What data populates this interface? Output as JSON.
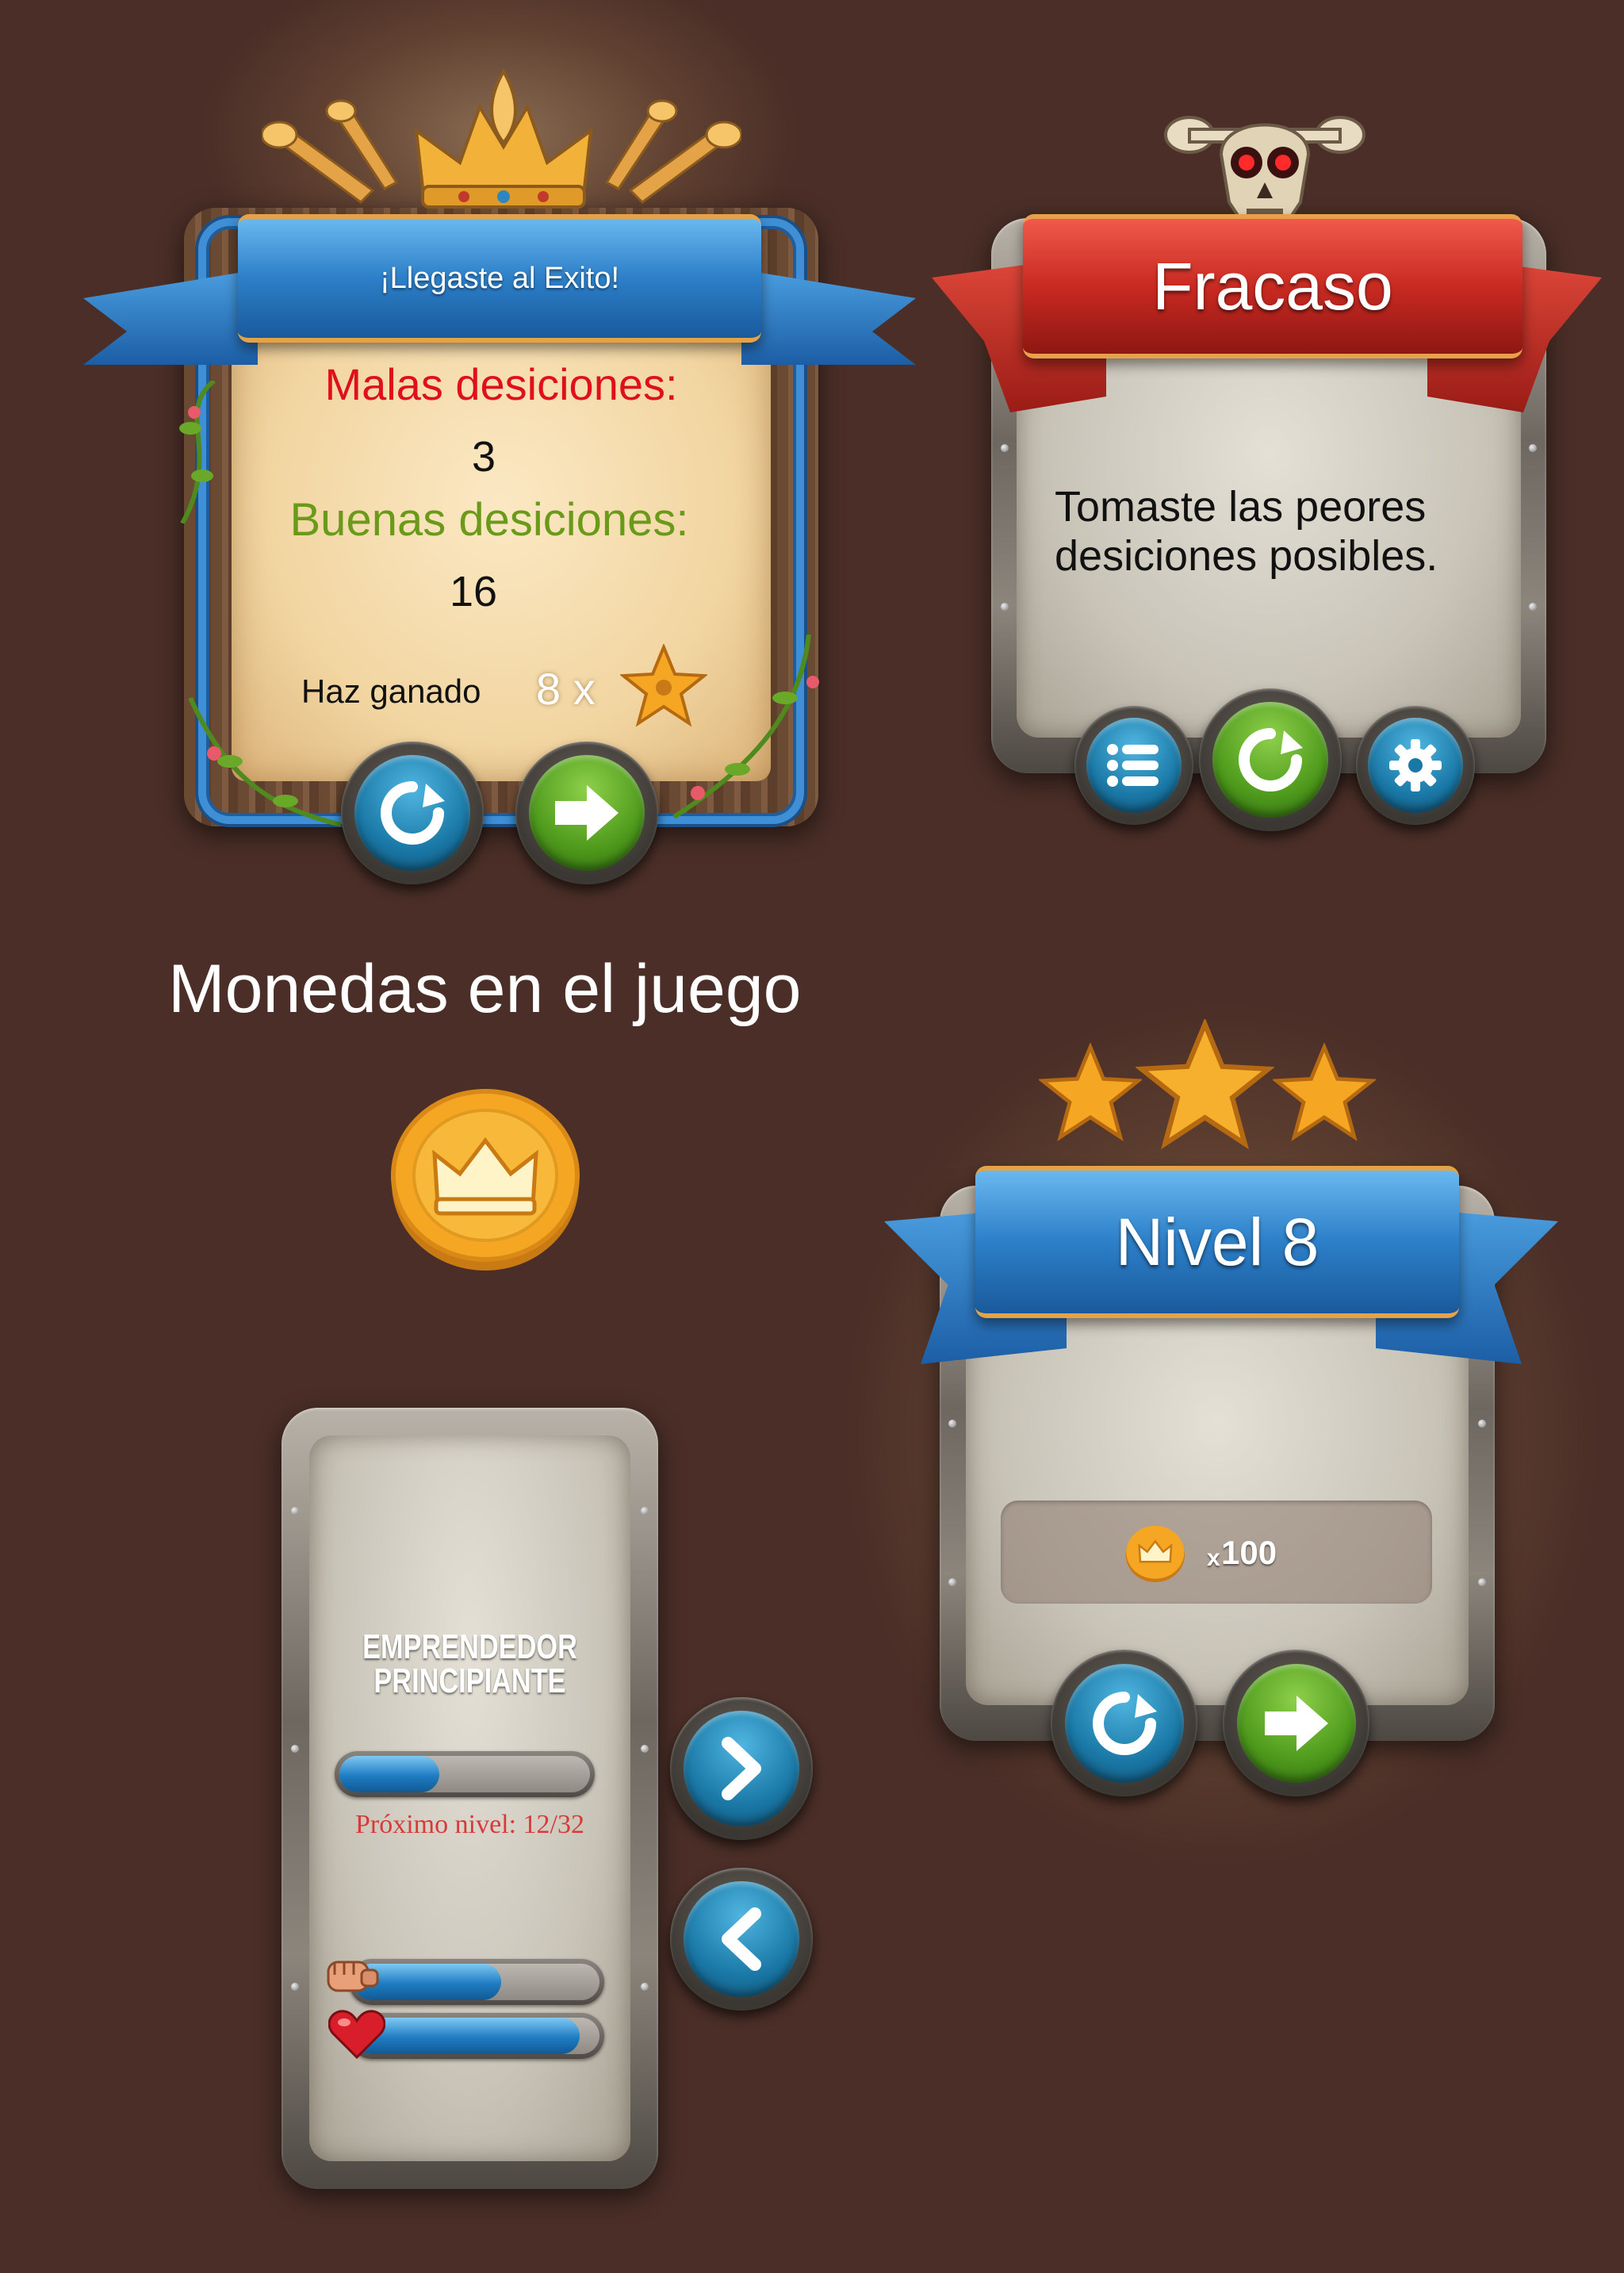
{
  "colors": {
    "background": "#4a2e27",
    "bad_red": "#e0101a",
    "good_green": "#6a9a1a",
    "progress_red": "#d83a3a",
    "ribbon_blue": "#2c7fc8",
    "ribbon_red": "#c92a22",
    "button_blue": "#1a78a6",
    "button_green": "#4e9a1c",
    "gold": "#f5a623"
  },
  "success_panel": {
    "title": "¡Llegaste al Exito!",
    "bad_label": "Malas desiciones:",
    "bad_value": "3",
    "good_label": "Buenas desiciones:",
    "good_value": "16",
    "earned_label": "Haz ganado",
    "earned_multiplier": "8 x",
    "icons": [
      "crown-icon",
      "trumpet-icon",
      "star-icon",
      "vine-icon"
    ],
    "buttons": [
      "retry-icon",
      "next-arrow-icon"
    ]
  },
  "failure_panel": {
    "title": "Fracaso",
    "message_line1": "Tomaste las peores",
    "message_line2": "desiciones posibles.",
    "icons": [
      "skull-icon"
    ],
    "buttons": [
      "menu-list-icon",
      "retry-icon",
      "gear-icon"
    ]
  },
  "coins_section": {
    "title": "Monedas en el juego",
    "icon": "crown-coin-icon"
  },
  "level_panel": {
    "title": "Nivel 8",
    "stars": 3,
    "reward_prefix": "x",
    "reward_amount": "100",
    "buttons": [
      "retry-icon",
      "next-arrow-icon"
    ]
  },
  "profile_panel": {
    "rank_line1": "EMPRENDEDOR",
    "rank_line2": "PRINCIPIANTE",
    "xp_fraction": 0.4,
    "next_level_text": "Próximo nivel: 12/32",
    "strength_fraction": 0.6,
    "health_fraction": 0.92,
    "stat_icons": [
      "fist-icon",
      "heart-icon"
    ],
    "nav_buttons": [
      "chevron-right-icon",
      "chevron-left-icon"
    ]
  }
}
